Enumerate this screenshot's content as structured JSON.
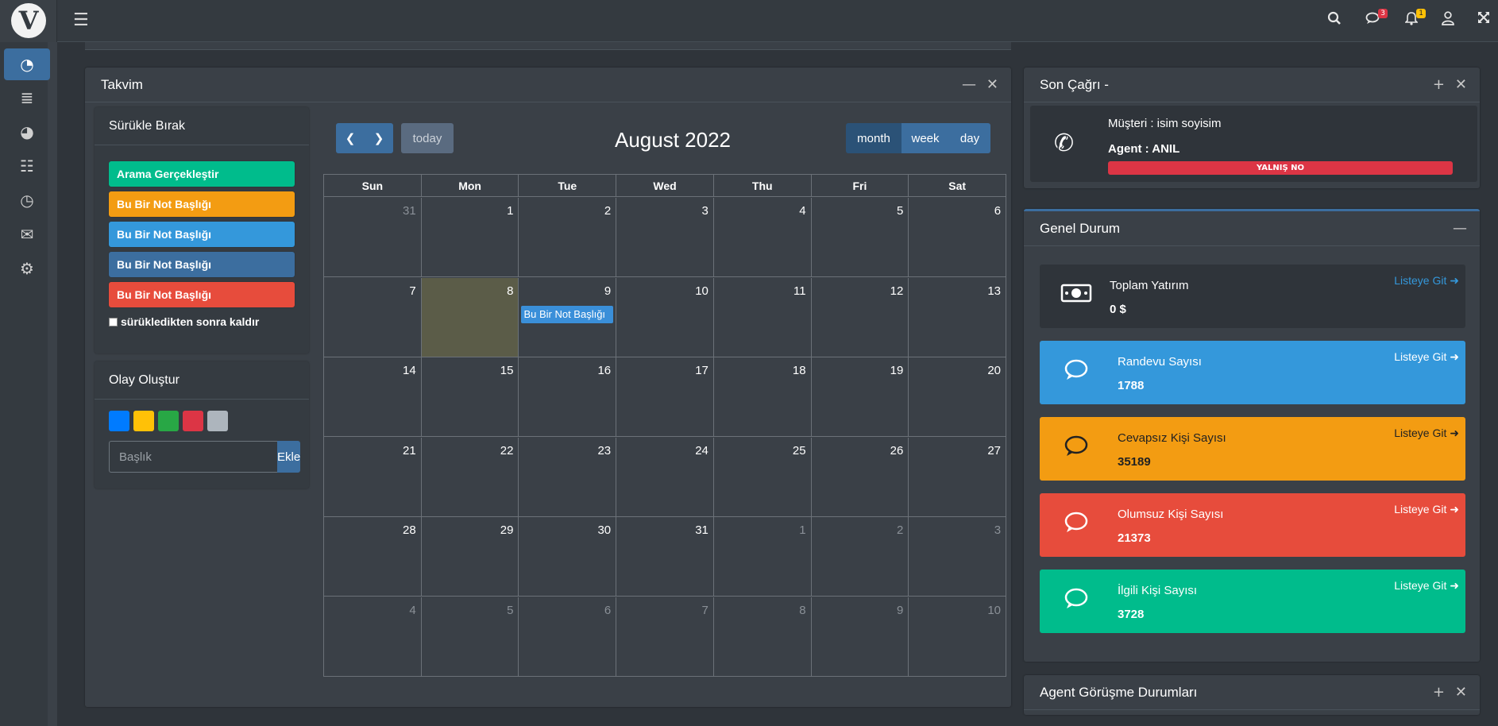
{
  "topbar": {
    "logo_letter": "V",
    "badges": {
      "chat": "3",
      "bell": "1"
    },
    "colors": {
      "chat_badge": "#dc3545",
      "bell_badge": "#ffc107"
    }
  },
  "sidebar": {
    "items": [
      {
        "icon": "dashboard-icon",
        "active": true
      },
      {
        "icon": "database-icon",
        "active": false
      },
      {
        "icon": "pie-chart-icon",
        "active": false
      },
      {
        "icon": "list-icon",
        "active": false
      },
      {
        "icon": "clock-icon",
        "active": false
      },
      {
        "icon": "sms-icon",
        "active": false
      },
      {
        "icon": "gears-icon",
        "active": false
      }
    ]
  },
  "calendar_panel": {
    "title": "Takvim",
    "drag": {
      "title": "Sürükle Bırak",
      "events": [
        {
          "label": "Arama Gerçekleştir",
          "color": "#00bc8c"
        },
        {
          "label": "Bu Bir Not Başlığı",
          "color": "#f39c12"
        },
        {
          "label": "Bu Bir Not Başlığı",
          "color": "#3498db"
        },
        {
          "label": "Bu Bir Not Başlığı",
          "color": "#3c6e9f"
        },
        {
          "label": "Bu Bir Not Başlığı",
          "color": "#e74c3c"
        }
      ],
      "remove_after_drop": "sürükledikten sonra kaldır"
    },
    "create": {
      "title": "Olay Oluştur",
      "colors": [
        "#007bff",
        "#ffc107",
        "#28a745",
        "#dc3545",
        "#adb5bd"
      ],
      "placeholder": "Başlık",
      "add_label": "Ekle"
    },
    "calendar": {
      "title": "August 2022",
      "today_label": "today",
      "views": [
        "month",
        "week",
        "day"
      ],
      "active_view": "month",
      "dow": [
        "Sun",
        "Mon",
        "Tue",
        "Wed",
        "Thu",
        "Fri",
        "Sat"
      ],
      "weeks": [
        [
          "31",
          "1",
          "2",
          "3",
          "4",
          "5",
          "6"
        ],
        [
          "7",
          "8",
          "9",
          "10",
          "11",
          "12",
          "13"
        ],
        [
          "14",
          "15",
          "16",
          "17",
          "18",
          "19",
          "20"
        ],
        [
          "21",
          "22",
          "23",
          "24",
          "25",
          "26",
          "27"
        ],
        [
          "28",
          "29",
          "30",
          "31",
          "1",
          "2",
          "3"
        ],
        [
          "4",
          "5",
          "6",
          "7",
          "8",
          "9",
          "10"
        ]
      ],
      "event": {
        "label": "Bu Bir Not Başlığı",
        "day": "9",
        "color": "#3a8fd9"
      },
      "today_day": "8"
    }
  },
  "last_call": {
    "title": "Son Çağrı -",
    "customer": "Müşteri : isim soyisim",
    "agent": "Agent : ANIL",
    "status": "YALNIŞ NO",
    "status_color": "#dc3545"
  },
  "general": {
    "title": "Genel Durum",
    "link_label": "Listeye Git",
    "stats": [
      {
        "label": "Toplam Yatırım",
        "value": "0 $",
        "color": "#2f343a",
        "icon": "money-icon",
        "link_color": "#3498db"
      },
      {
        "label": "Randevu Sayısı",
        "value": "1788",
        "color": "#3498db",
        "icon": "comment-icon",
        "link_color": "#ffffff"
      },
      {
        "label": "Cevapsız Kişi Sayısı",
        "value": "35189",
        "color": "#f39c12",
        "icon": "comment-icon",
        "link_color": "#222222"
      },
      {
        "label": "Olumsuz Kişi Sayısı",
        "value": "21373",
        "color": "#e74c3c",
        "icon": "comment-icon",
        "link_color": "#ffffff"
      },
      {
        "label": "İlgili Kişi Sayısı",
        "value": "3728",
        "color": "#00bc8c",
        "icon": "comment-icon",
        "link_color": "#ffffff"
      }
    ]
  },
  "agent_panel": {
    "title": "Agent Görüşme Durumları"
  }
}
